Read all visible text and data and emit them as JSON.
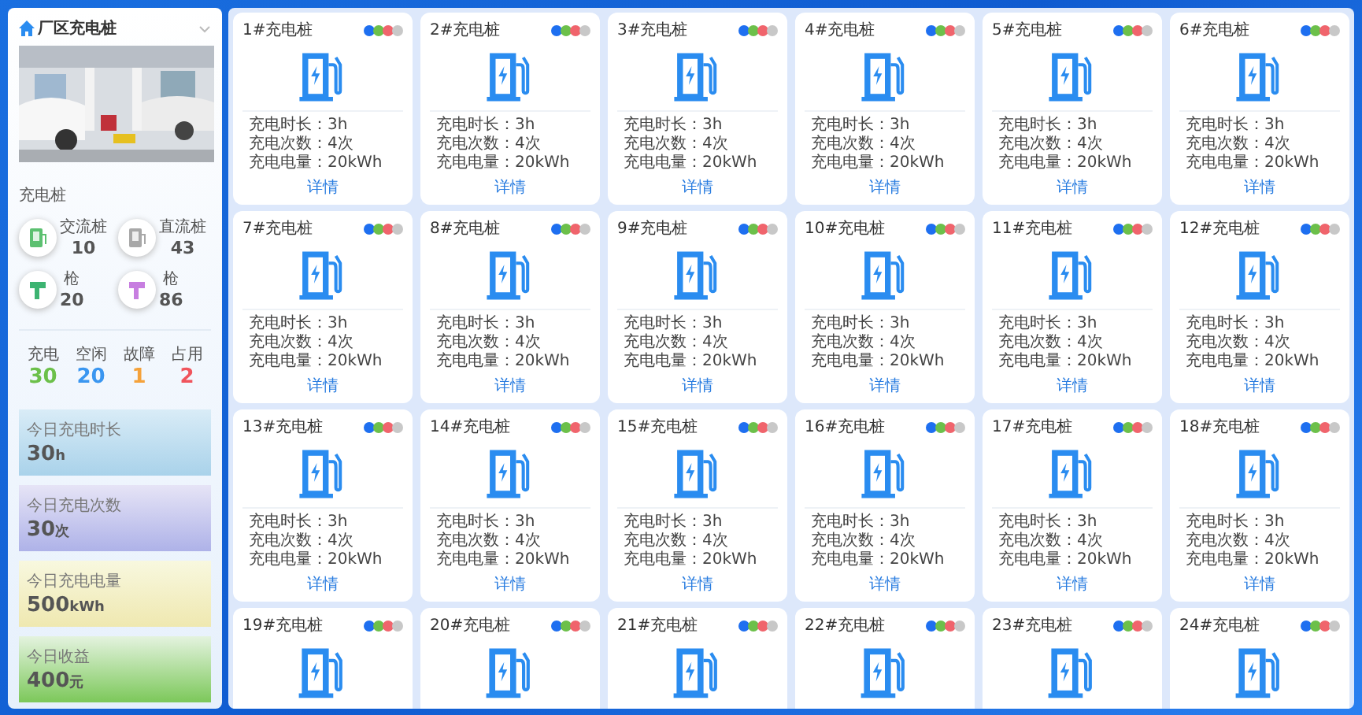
{
  "sidebar": {
    "title": "厂区充电桩",
    "expanded": false,
    "section_label": "充电桩",
    "pile_stats": [
      {
        "kind": "ac",
        "label": "交流桩",
        "value": "10"
      },
      {
        "kind": "dc",
        "label": "直流桩",
        "value": "43"
      },
      {
        "kind": "gun",
        "color": "#3cb371",
        "label": "枪",
        "value": "20"
      },
      {
        "kind": "gun",
        "color": "#c77ee0",
        "label": "枪",
        "value": "86"
      }
    ],
    "status_counts": [
      {
        "label": "充电",
        "value": "30",
        "color": "#6cc04a"
      },
      {
        "label": "空闲",
        "value": "20",
        "color": "#3a96f0"
      },
      {
        "label": "故障",
        "value": "1",
        "color": "#f5a23a"
      },
      {
        "label": "占用",
        "value": "2",
        "color": "#f0545c"
      }
    ],
    "summaries": [
      {
        "kind": "blue",
        "label": "今日充电时长",
        "value": "30",
        "unit": "h"
      },
      {
        "kind": "purple",
        "label": "今日充电次数",
        "value": "30",
        "unit": "次"
      },
      {
        "kind": "yellow",
        "label": "今日充电电量",
        "value": "500",
        "unit": "kWh"
      },
      {
        "kind": "green",
        "label": "今日收益",
        "value": "400",
        "unit": "元"
      }
    ]
  },
  "status_legend": [
    {
      "color": "#1e6ff0"
    },
    {
      "color": "#6cc04a"
    },
    {
      "color": "#f0646c"
    },
    {
      "color": "#c8c8c8"
    }
  ],
  "piles": [
    {
      "title": "1#充电桩",
      "stats": [
        "充电时长：3h",
        "充电次数：4次",
        "充电电量：20kWh"
      ],
      "link": "详情"
    },
    {
      "title": "2#充电桩",
      "stats": [
        "充电时长：3h",
        "充电次数：4次",
        "充电电量：20kWh"
      ],
      "link": "详情"
    },
    {
      "title": "3#充电桩",
      "stats": [
        "充电时长：3h",
        "充电次数：4次",
        "充电电量：20kWh"
      ],
      "link": "详情"
    },
    {
      "title": "4#充电桩",
      "stats": [
        "充电时长：3h",
        "充电次数：4次",
        "充电电量：20kWh"
      ],
      "link": "详情"
    },
    {
      "title": "5#充电桩",
      "stats": [
        "充电时长：3h",
        "充电次数：4次",
        "充电电量：20kWh"
      ],
      "link": "详情"
    },
    {
      "title": "6#充电桩",
      "stats": [
        "充电时长：3h",
        "充电次数：4次",
        "充电电量：20kWh"
      ],
      "link": "详情"
    },
    {
      "title": "7#充电桩",
      "stats": [
        "充电时长：3h",
        "充电次数：4次",
        "充电电量：20kWh"
      ],
      "link": "详情"
    },
    {
      "title": "8#充电桩",
      "stats": [
        "充电时长：3h",
        "充电次数：4次",
        "充电电量：20kWh"
      ],
      "link": "详情"
    },
    {
      "title": "9#充电桩",
      "stats": [
        "充电时长：3h",
        "充电次数：4次",
        "充电电量：20kWh"
      ],
      "link": "详情"
    },
    {
      "title": "10#充电桩",
      "stats": [
        "充电时长：3h",
        "充电次数：4次",
        "充电电量：20kWh"
      ],
      "link": "详情"
    },
    {
      "title": "11#充电桩",
      "stats": [
        "充电时长：3h",
        "充电次数：4次",
        "充电电量：20kWh"
      ],
      "link": "详情"
    },
    {
      "title": "12#充电桩",
      "stats": [
        "充电时长：3h",
        "充电次数：4次",
        "充电电量：20kWh"
      ],
      "link": "详情"
    },
    {
      "title": "13#充电桩",
      "stats": [
        "充电时长：3h",
        "充电次数：4次",
        "充电电量：20kWh"
      ],
      "link": "详情"
    },
    {
      "title": "14#充电桩",
      "stats": [
        "充电时长：3h",
        "充电次数：4次",
        "充电电量：20kWh"
      ],
      "link": "详情"
    },
    {
      "title": "15#充电桩",
      "stats": [
        "充电时长：3h",
        "充电次数：4次",
        "充电电量：20kWh"
      ],
      "link": "详情"
    },
    {
      "title": "16#充电桩",
      "stats": [
        "充电时长：3h",
        "充电次数：4次",
        "充电电量：20kWh"
      ],
      "link": "详情"
    },
    {
      "title": "17#充电桩",
      "stats": [
        "充电时长：3h",
        "充电次数：4次",
        "充电电量：20kWh"
      ],
      "link": "详情"
    },
    {
      "title": "18#充电桩",
      "stats": [
        "充电时长：3h",
        "充电次数：4次",
        "充电电量：20kWh"
      ],
      "link": "详情"
    },
    {
      "title": "19#充电桩"
    },
    {
      "title": "20#充电桩"
    },
    {
      "title": "21#充电桩"
    },
    {
      "title": "22#充电桩"
    },
    {
      "title": "23#充电桩"
    },
    {
      "title": "24#充电桩"
    }
  ]
}
